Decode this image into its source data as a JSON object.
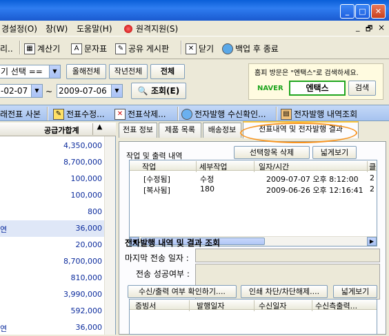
{
  "menu": {
    "items": [
      "경설정(O)",
      "창(W)",
      "도움말(H)",
      "원격지원(S)"
    ],
    "mdi_controls": [
      "_",
      "🗗",
      "×"
    ]
  },
  "toolbar": {
    "partial": "리..",
    "calculator": "계산기",
    "text_table": "문자표",
    "share_board": "공유 게시판",
    "close": "닫기",
    "backup_exit": "백업 후 종료"
  },
  "filter": {
    "period_select": "기 선택 ==",
    "this_year": "올해전체",
    "last_year": "작년전체",
    "all": "전체",
    "date_from": "-02-07",
    "date_to": "2009-07-06",
    "tilde": "~",
    "search": "조회(E)"
  },
  "banner": {
    "text": "홈피 방문은 \"엔택스\"로 검색하세요.",
    "naver": "NAVER",
    "keyword": "엔택스",
    "search": "검색"
  },
  "actions": {
    "copy": "래전표 사본",
    "edit": "전표수정...",
    "delete": "전표삭제...",
    "confirm": "전자발행 수신확인...",
    "history": "전자발행 내역조회"
  },
  "left_list": {
    "header": "공급가합계",
    "header_sort": "▲",
    "rows": [
      {
        "label": "",
        "value": "4,350,000"
      },
      {
        "label": "",
        "value": "8,700,000"
      },
      {
        "label": "",
        "value": "100,000"
      },
      {
        "label": "",
        "value": "100,000"
      },
      {
        "label": "",
        "value": "800"
      },
      {
        "label": "연",
        "value": "36,000"
      },
      {
        "label": "",
        "value": "20,000"
      },
      {
        "label": "",
        "value": "8,700,000"
      },
      {
        "label": "",
        "value": "810,000"
      },
      {
        "label": "",
        "value": "3,990,000"
      },
      {
        "label": "",
        "value": "592,000"
      },
      {
        "label": "연",
        "value": "36,000"
      }
    ]
  },
  "tabs": [
    "전표 정보",
    "제품 목록",
    "배송정보",
    "전표내역 및 전자발행 결과"
  ],
  "work_history": {
    "title": "작업 및 출력 내역",
    "delete_selected": "선택항목 삭제",
    "wide_view": "넓게보기",
    "columns": [
      "작업",
      "세부작업",
      "일자/시간",
      "클"
    ],
    "rows": [
      {
        "job": "[수정됨]",
        "detail": "수정",
        "datetime": "2009-07-07 오후 8:12:00",
        "extra": "2"
      },
      {
        "job": "[복사됨]",
        "detail": "180",
        "datetime": "2009-06-26 오후 12:16:41",
        "extra": "2"
      }
    ]
  },
  "e_issue": {
    "title": "전자발행 내역 및 결과 조회",
    "last_send_label": "마지막 전송 일자 :",
    "send_success_label": "전송 성공여부 :",
    "check_button": "수신/출력 여부 확인하기....",
    "print_block_button": "인쇄 차단/차단해제....",
    "wide_view": "넓게보기",
    "columns": [
      "증빙서",
      "발행일자",
      "수신일자",
      "수신측출력..."
    ]
  }
}
